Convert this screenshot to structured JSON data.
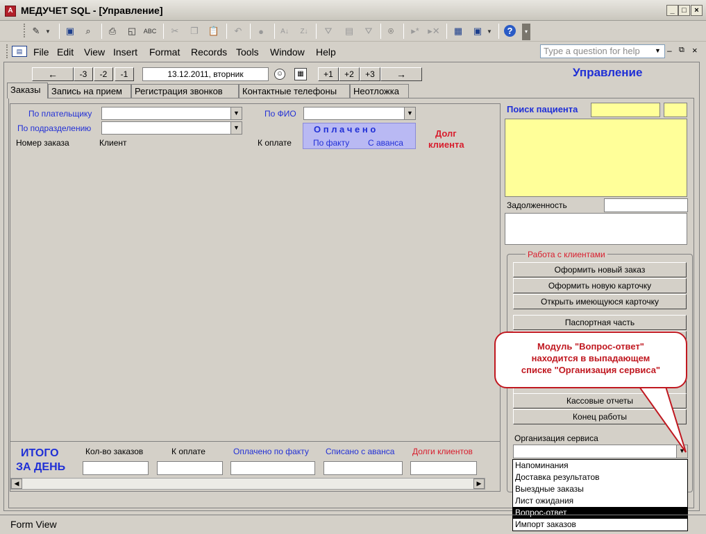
{
  "window": {
    "title": "МЕДУЧЕТ SQL - [Управление]",
    "app_icon": "access-icon",
    "controls": [
      "_",
      "□",
      "×"
    ]
  },
  "menu": {
    "items": [
      "File",
      "Edit",
      "View",
      "Insert",
      "Format",
      "Records",
      "Tools",
      "Window",
      "Help"
    ],
    "help_placeholder": "Type a question for help"
  },
  "nav": {
    "back": "←",
    "minus3": "-3",
    "minus2": "-2",
    "minus1": "-1",
    "date": "13.12.2011, вторник",
    "plus1": "+1",
    "plus2": "+2",
    "plus3": "+3",
    "forward": "→"
  },
  "heading": "Управление",
  "tabs": [
    "Заказы",
    "Запись на прием",
    "Регистрация звонков",
    "Контактные телефоны",
    "Неотложка"
  ],
  "orders": {
    "by_payer": "По плательщику",
    "by_department": "По подразделению",
    "by_name": "По ФИО",
    "order_number": "Номер заказа",
    "client": "Клиент",
    "to_pay": "К оплате",
    "paid_title": "О п л а ч е н о",
    "paid_actual": "По факту",
    "paid_advance": "С аванса",
    "debt_line1": "Долг",
    "debt_line2": "клиента"
  },
  "totals": {
    "title_line1": "ИТОГО",
    "title_line2": "ЗА ДЕНЬ",
    "orders_count": "Кол-во заказов",
    "to_pay": "К оплате",
    "paid_actual": "Оплачено по факту",
    "written_advance": "Списано с аванса",
    "client_debts": "Долги клиентов"
  },
  "patient": {
    "search_label": "Поиск пациента",
    "debt_label": "Задолженность"
  },
  "clients_group": {
    "title": "Работа с клиентами",
    "buttons": {
      "new_order": "Оформить новый заказ",
      "new_card": "Оформить новую карточку",
      "open_card": "Открыть имеющуюся карточку",
      "passport": "Паспортная часть",
      "cash_reports": "Кассовые отчеты",
      "end_work": "Конец работы"
    },
    "service_label": "Организация сервиса"
  },
  "service_dropdown": {
    "options": [
      "Напоминания",
      "Доставка результатов",
      "Выездные заказы",
      "Лист ожидания",
      "Вопрос-ответ",
      "Импорт заказов"
    ],
    "selected_index": 4
  },
  "callout": {
    "line1": "Модуль \"Вопрос-ответ\"",
    "line2": "находится в выпадающем",
    "line3": "списке \"Организация сервиса\""
  },
  "status": "Form View"
}
